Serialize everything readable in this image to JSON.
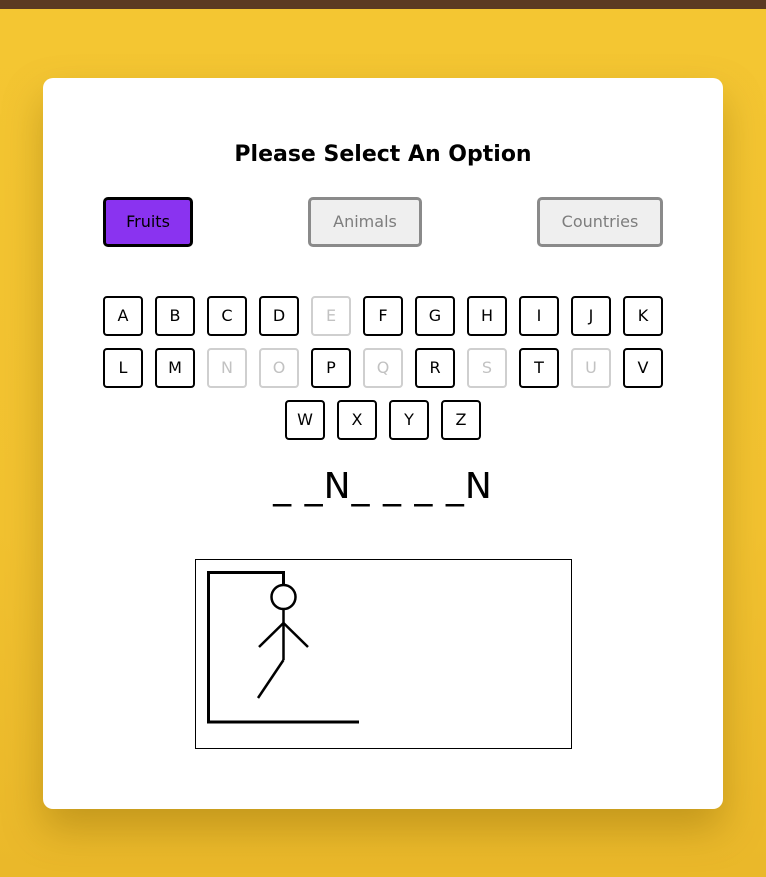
{
  "heading": "Please Select An Option",
  "options": [
    {
      "label": "Fruits",
      "active": true
    },
    {
      "label": "Animals",
      "active": false
    },
    {
      "label": "Countries",
      "active": false
    }
  ],
  "keyboard": {
    "rows": [
      [
        {
          "letter": "A",
          "used": false
        },
        {
          "letter": "B",
          "used": false
        },
        {
          "letter": "C",
          "used": false
        },
        {
          "letter": "D",
          "used": false
        },
        {
          "letter": "E",
          "used": true
        },
        {
          "letter": "F",
          "used": false
        },
        {
          "letter": "G",
          "used": false
        },
        {
          "letter": "H",
          "used": false
        },
        {
          "letter": "I",
          "used": false
        },
        {
          "letter": "J",
          "used": false
        },
        {
          "letter": "K",
          "used": false
        }
      ],
      [
        {
          "letter": "L",
          "used": false
        },
        {
          "letter": "M",
          "used": false
        },
        {
          "letter": "N",
          "used": true
        },
        {
          "letter": "O",
          "used": true
        },
        {
          "letter": "P",
          "used": false
        },
        {
          "letter": "Q",
          "used": true
        },
        {
          "letter": "R",
          "used": false
        },
        {
          "letter": "S",
          "used": true
        },
        {
          "letter": "T",
          "used": false
        },
        {
          "letter": "U",
          "used": true
        },
        {
          "letter": "V",
          "used": false
        }
      ],
      [
        {
          "letter": "W",
          "used": false
        },
        {
          "letter": "X",
          "used": false
        },
        {
          "letter": "Y",
          "used": false
        },
        {
          "letter": "Z",
          "used": false
        }
      ]
    ]
  },
  "word_display": "_ _N_ _ _ _N",
  "hangman": {
    "parts_drawn": [
      "base",
      "pole",
      "beam",
      "rope",
      "head",
      "body",
      "left-arm",
      "right-arm",
      "left-leg"
    ],
    "stroke_color": "#000000"
  },
  "colors": {
    "background": "#f4c632",
    "top_bar": "#5b3a22",
    "active_option": "#8a33f0"
  }
}
